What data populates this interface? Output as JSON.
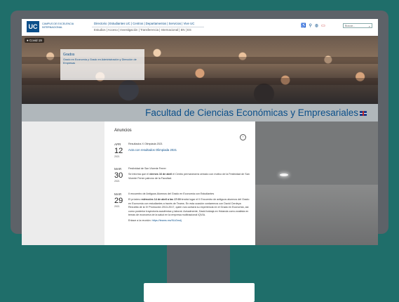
{
  "header": {
    "logo": "UC",
    "campus": "CAMPUS DE EXCELENCIA INTERNACIONAL",
    "nav_primary": "Directorio | Estudiantes UC | Centros | Departamentos | Servicios | Vive UC",
    "nav_secondary": "Estudios | Acceso | Investigación | Transferencia | Internacional | EN | ES",
    "search_placeholder": "Buscar...",
    "icons": [
      "accessibility-icon",
      "location-icon",
      "globe-icon",
      "screen-icon"
    ]
  },
  "hero": {
    "covid_badge": "Covid 19",
    "card_title": "Grados",
    "card_link": "Grado en Economía y Grado en Administración y Dirección de Empresas"
  },
  "faculty": {
    "title": "Facultad de Ciencias Económicas y Empresariales"
  },
  "announcements": {
    "heading": "Anuncios",
    "items": [
      {
        "month": "APR",
        "day": "12",
        "year": "2021",
        "title": "Resultados X Olimpiada 2021",
        "link": "Acta con resultados Olimpiada 2021"
      },
      {
        "month": "MAR",
        "day": "30",
        "year": "2021",
        "title": "Festividad de San Vicente Ferrer",
        "text_before": "Se informa que el ",
        "bold": "viernes 16 de abril",
        "text_after": " el Centro permanecerá cerrado con motivo de la Festividad de San Vicente Ferrer patrono de la Facultad."
      },
      {
        "month": "MAR",
        "day": "29",
        "year": "2021",
        "title": "II encuentro de Antiguos Alumnos del Grado en Economía con Estudiantes",
        "text_before": "El próximo ",
        "bold": "miércoles 14 de abril a las 17:00",
        "text_after": " tendrá lugar el II Encuentro de antiguos alumnos del Grado en Economía con estudiantes a través de Teams. En esta ocasión contaremos con David Cerdeya Revuelta de la IV Promoción 2013-2017, quien nos contará su experiencia en el Grado en Economía, así como posterior trayectoria académica y laboral. Actualmente, David trabaja en Holanda como analista en temas de economía de la salud en la empresa multinacional IQVIA.",
        "link_prefix": "Enlace a la reunión: ",
        "link": "https://teams.ms/9Lk3mdj"
      }
    ]
  }
}
